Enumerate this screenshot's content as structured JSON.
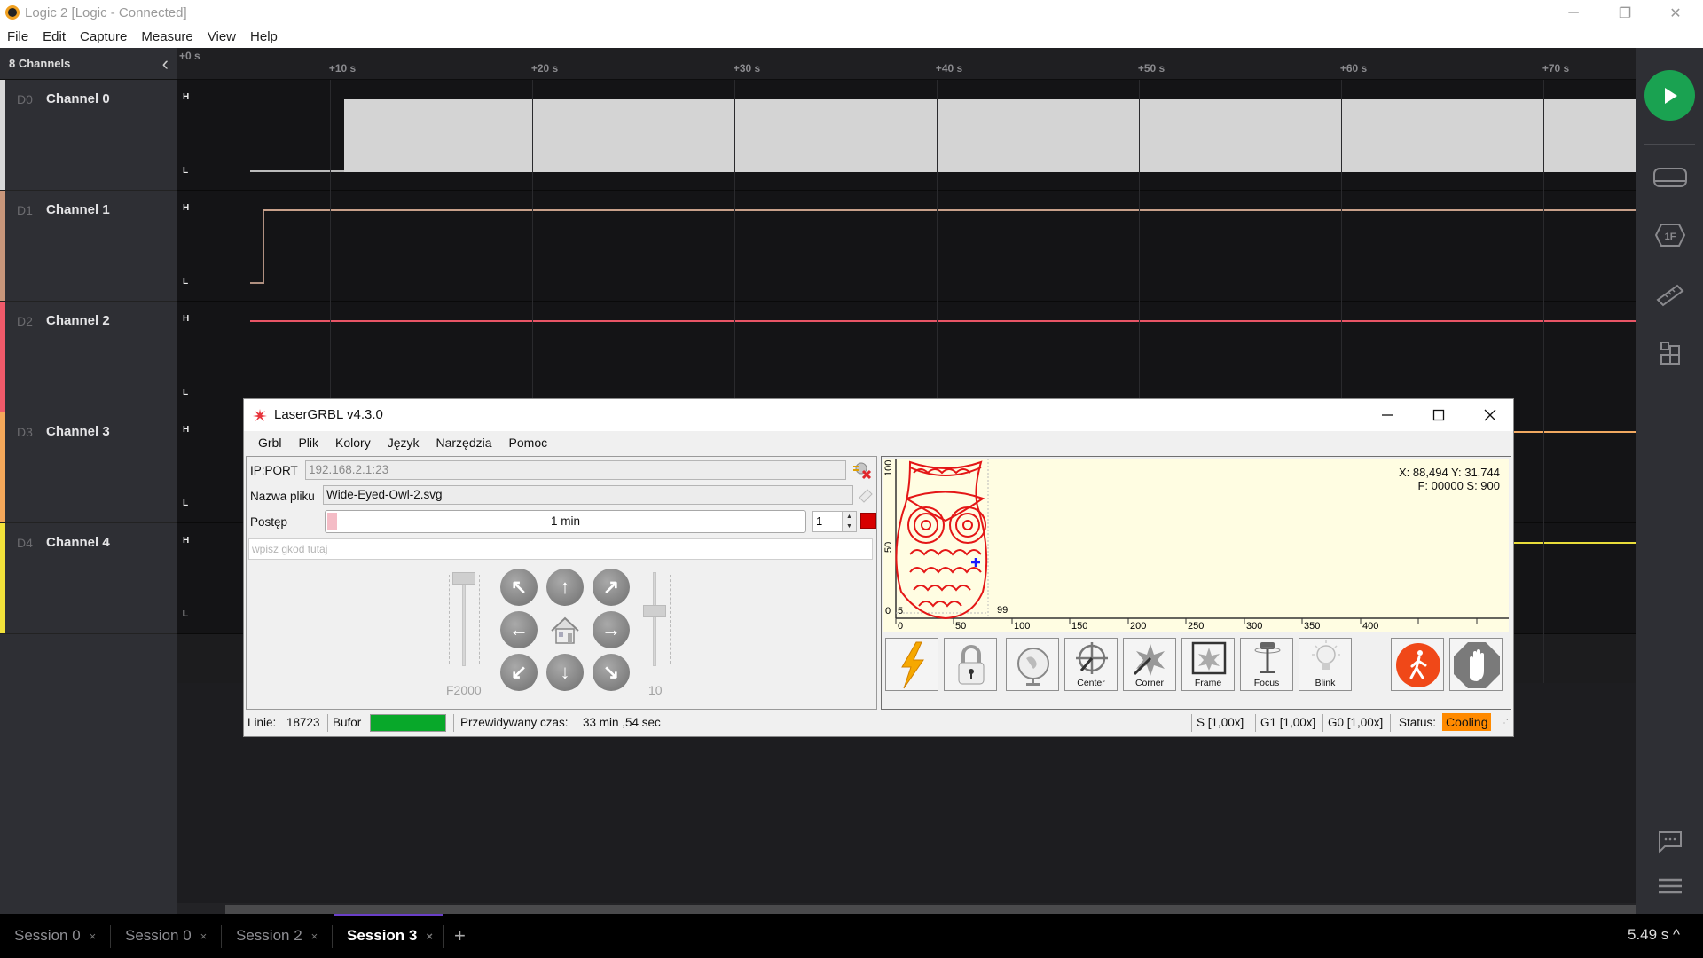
{
  "window": {
    "title": "Logic 2 [Logic - Connected]",
    "controls": {
      "minimize": "─",
      "restore": "❐",
      "close": "✕"
    }
  },
  "menu": [
    "File",
    "Edit",
    "Capture",
    "Measure",
    "View",
    "Help"
  ],
  "sidebar": {
    "header": "8 Channels",
    "collapse_icon": "‹",
    "channels": [
      {
        "id": "D0",
        "name": "Channel 0",
        "color": "#d8d8d8"
      },
      {
        "id": "D1",
        "name": "Channel 1",
        "color": "#c8967a"
      },
      {
        "id": "D2",
        "name": "Channel 2",
        "color": "#f05a6a"
      },
      {
        "id": "D3",
        "name": "Channel 3",
        "color": "#f5a85a"
      },
      {
        "id": "D4",
        "name": "Channel 4",
        "color": "#f2e23a"
      }
    ]
  },
  "timeline": {
    "start": "+0 s",
    "ticks": [
      "+10 s",
      "+20 s",
      "+30 s",
      "+40 s",
      "+50 s",
      "+60 s",
      "+70 s"
    ],
    "high_label": "H",
    "low_label": "L",
    "signals": [
      {
        "channel": "D0",
        "initial": "low",
        "transition_s": 7.5,
        "state_after": "high-dense"
      },
      {
        "channel": "D1",
        "initial": "low",
        "transition_s": 0.5,
        "state_after": "high"
      },
      {
        "channel": "D2",
        "initial": "high"
      },
      {
        "channel": "D3",
        "initial": "high"
      },
      {
        "channel": "D4",
        "initial": "high"
      }
    ]
  },
  "rightbar": {
    "play": "start-capture",
    "icons": [
      "analyzers-icon",
      "one-frame-icon",
      "measure-ruler-icon",
      "extensions-icon",
      "chat-icon",
      "menu-icon"
    ]
  },
  "tabs": [
    {
      "label": "Session 0",
      "active": false
    },
    {
      "label": "Session 0",
      "active": false
    },
    {
      "label": "Session 2",
      "active": false
    },
    {
      "label": "Session 3",
      "active": true
    }
  ],
  "tab_close": "×",
  "tab_add": "+",
  "time_readout": "5.49 s ^",
  "lasergrbl": {
    "title": "LaserGRBL v4.3.0",
    "menu": [
      "Grbl",
      "Plik",
      "Kolory",
      "Język",
      "Narzędzia",
      "Pomoc"
    ],
    "ip_label": "IP:PORT",
    "ip_value": "192.168.2.1:23",
    "file_label": "Nazwa pliku",
    "file_value": "Wide-Eyed-Owl-2.svg",
    "progress_label": "Postęp",
    "progress_text": "1 min",
    "progress_fraction": 0.02,
    "copies_value": "1",
    "gcode_placeholder": "wpisz gkod tutaj",
    "speed_label": "F2000",
    "step_label": "10",
    "speed_slider_fraction": 1.0,
    "step_slider_fraction": 0.6,
    "coords_line1": "X: 88,494 Y: 31,744",
    "coords_line2": "F: 00000 S: 900",
    "preview_labels": {
      "y_100": "100",
      "y_50": "50",
      "y_0": "0",
      "origin": "5",
      "width_mark": "99"
    },
    "x_ticks": [
      "0",
      "50",
      "100",
      "150",
      "200",
      "250",
      "300",
      "350",
      "400"
    ],
    "tool_buttons": [
      {
        "name": "reset",
        "label": ""
      },
      {
        "name": "unlock",
        "label": ""
      },
      {
        "name": "goto-position",
        "label": ""
      },
      {
        "name": "center",
        "label": "Center"
      },
      {
        "name": "corner",
        "label": "Corner"
      },
      {
        "name": "frame",
        "label": "Frame"
      },
      {
        "name": "focus",
        "label": "Focus"
      },
      {
        "name": "blink",
        "label": "Blink"
      }
    ],
    "status": {
      "lines_label": "Linie:",
      "lines_value": "18723",
      "buffer_label": "Bufor",
      "eta_label": "Przewidywany czas:",
      "eta_value": "33 min ,54 sec",
      "s_override": "S [1,00x]",
      "g1_override": "G1 [1,00x]",
      "g0_override": "G0 [1,00x]",
      "status_label": "Status:",
      "status_value": "Cooling",
      "status_color": "#ff8a00"
    }
  }
}
